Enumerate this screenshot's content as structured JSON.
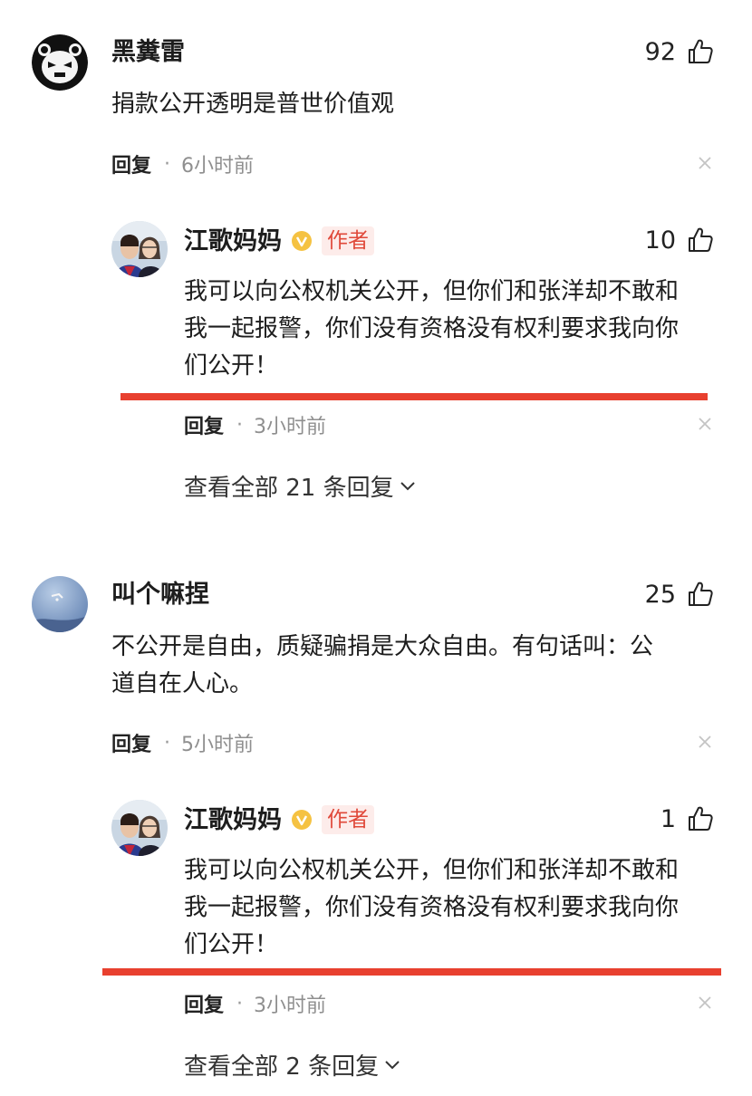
{
  "comments": [
    {
      "username": "黑糞雷",
      "likes": "92",
      "text": "捐款公开透明是普世价值观",
      "reply_label": "回复",
      "separator": "·",
      "time": "6小时前",
      "reply": {
        "username": "江歌妈妈",
        "author_tag": "作者",
        "likes": "10",
        "text_line1": "我可以向公权机关公开，但你们和张洋却不敢和",
        "text_line2": "我一起报警，你们没有资格没有权利要求我向你",
        "text_line3": "们公开！",
        "reply_label": "回复",
        "separator": "·",
        "time": "3小时前"
      },
      "view_all": "查看全部 21 条回复"
    },
    {
      "username": "叫个嘛捏",
      "likes": "25",
      "text_line1": "不公开是自由，质疑骗捐是大众自由。有句话叫：公",
      "text_line2": "道自在人心。",
      "reply_label": "回复",
      "separator": "·",
      "time": "5小时前",
      "reply": {
        "username": "江歌妈妈",
        "author_tag": "作者",
        "likes": "1",
        "text_line1": "我可以向公权机关公开，但你们和张洋却不敢和",
        "text_line2": "我一起报警，你们没有资格没有权利要求我向你",
        "text_line3": "们公开！",
        "reply_label": "回复",
        "separator": "·",
        "time": "3小时前"
      },
      "view_all": "查看全部 2 条回复"
    }
  ],
  "colors": {
    "highlight_bar": "#e8402f",
    "author_tag_bg": "#fdecea",
    "author_tag_text": "#e0493a",
    "verified_badge": "#f5c242"
  },
  "icons": {
    "like": "thumbs-up-icon",
    "close": "close-icon",
    "verified": "verified-badge-icon",
    "expand": "chevron-down-icon"
  }
}
